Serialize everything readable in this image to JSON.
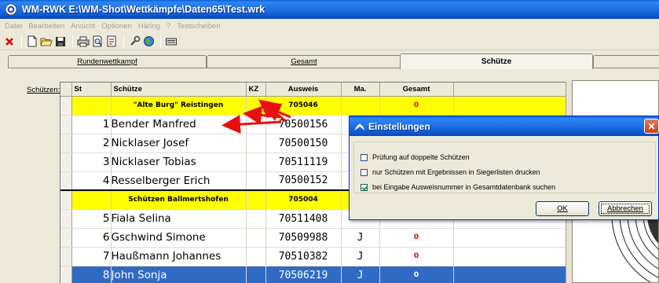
{
  "window": {
    "title": "WM-RWK E:\\WM-Shot\\Wettkämpfe\\Daten65\\Test.wrk"
  },
  "menu": [
    "Datei",
    "Bearbeiten",
    "Ansicht",
    "Optionen",
    "Häring",
    "?",
    "Testscheiben"
  ],
  "toolbar": [
    "close-icon",
    "new-file-icon",
    "open-folder-icon",
    "save-disk-icon",
    "print-icon",
    "print-preview-icon",
    "report-icon",
    "wrench-icon",
    "globe-icon",
    "printer-list-icon"
  ],
  "tabs": [
    {
      "label": "Rundenwettkampf",
      "active": false
    },
    {
      "label": "Gesamt",
      "active": false
    },
    {
      "label": "Schütze",
      "active": true
    },
    {
      "label": "",
      "active": false
    }
  ],
  "schuetzen_label": "Schützen:",
  "grid": {
    "columns": [
      "St",
      "Schütze",
      "KZ",
      "Ausweis",
      "Ma.",
      "Gesamt"
    ],
    "rows": [
      {
        "type": "club",
        "name": "\"Alte Burg\" Reistingen",
        "ausweis": "705046",
        "gesamt": "0"
      },
      {
        "type": "shooter",
        "nr": "1",
        "name": "Bender Manfred",
        "ausweis": "70500156",
        "ma": "",
        "gesamt": ""
      },
      {
        "type": "shooter",
        "nr": "2",
        "name": "Nicklaser Josef",
        "ausweis": "70500150",
        "ma": "",
        "gesamt": ""
      },
      {
        "type": "shooter",
        "nr": "3",
        "name": "Nicklaser Tobias",
        "ausweis": "70511119",
        "ma": "",
        "gesamt": ""
      },
      {
        "type": "shooter",
        "nr": "4",
        "name": "Resselberger Erich",
        "ausweis": "70500152",
        "ma": "",
        "gesamt": ""
      },
      {
        "type": "club",
        "name": "Schützen Ballmertshofen",
        "ausweis": "705004",
        "gesamt": ""
      },
      {
        "type": "shooter",
        "nr": "5",
        "name": "Fiala Selina",
        "ausweis": "70511408",
        "ma": "",
        "gesamt": ""
      },
      {
        "type": "shooter",
        "nr": "6",
        "name": "Gschwind Simone",
        "ausweis": "70509988",
        "ma": "J",
        "gesamt": "0"
      },
      {
        "type": "shooter",
        "nr": "7",
        "name": "Haußmann Johannes",
        "ausweis": "70510382",
        "ma": "J",
        "gesamt": "0"
      },
      {
        "type": "shooter",
        "nr": "8",
        "name": "John Sonja",
        "ausweis": "70506219",
        "ma": "J",
        "gesamt": "0",
        "selected": true
      }
    ]
  },
  "dialog": {
    "title": "Einstellungen",
    "options": [
      {
        "label": "Prüfung auf doppelte Schützen",
        "checked": false
      },
      {
        "label": "nur Schützen mit Ergebnissen in Siegerlisten drucken",
        "checked": false
      },
      {
        "label": "bei Eingabe Ausweisnummer in Gesamtdatenbank suchen",
        "checked": true
      }
    ],
    "ok_label": "OK",
    "cancel_label": "Abbrechen"
  },
  "colors": {
    "title_blue": "#1e6fe6",
    "club_yellow": "#ffff00",
    "selection_blue": "#316ac5",
    "arrow_red": "#e8100f"
  }
}
